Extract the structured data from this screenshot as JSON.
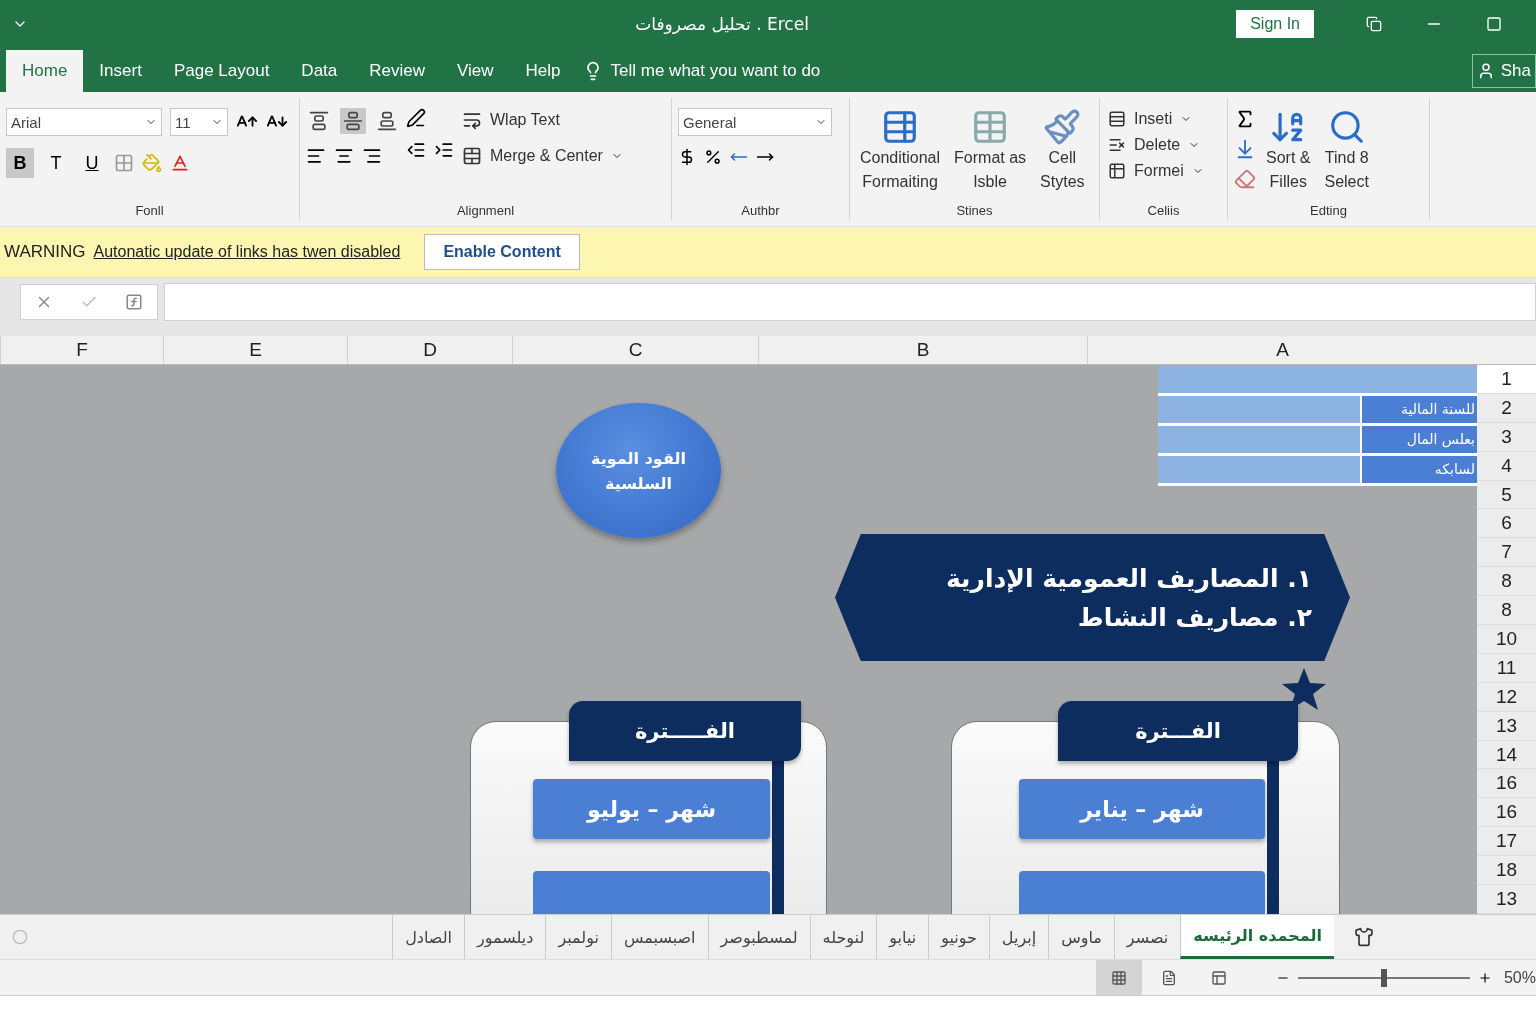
{
  "window": {
    "title": "تحليل مصروفات . Ercel",
    "sign_in": "Sign In",
    "share": "Sha"
  },
  "ribbon_tabs": {
    "home": {
      "label": "Home",
      "selected": true
    },
    "insert": {
      "label": "Insert",
      "selected": false
    },
    "page_layout": {
      "label": "Page Layout",
      "selected": false
    },
    "data": {
      "label": "Data",
      "selected": false
    },
    "review": {
      "label": "Review",
      "selected": false
    },
    "view": {
      "label": "View",
      "selected": false
    },
    "help": {
      "label": "Help",
      "selected": false
    }
  },
  "tell_me": "Tell me what you want to do",
  "ribbon": {
    "font": "Arial",
    "size": "11",
    "format_buttons": {
      "bold": {
        "label": "B",
        "selected": true
      },
      "italic": {
        "label": "T",
        "selected": false
      },
      "underline": {
        "label": "U",
        "selected": false
      }
    },
    "vertical_align": [
      {
        "selected": false
      },
      {
        "selected": true
      },
      {
        "selected": false
      }
    ],
    "wrap_text": "Wlap Text",
    "merge": "Merge & Center",
    "number_format": "General",
    "conditional": [
      "Conditional",
      "Formaiting"
    ],
    "format_table": [
      "Format as",
      "Isble"
    ],
    "cell_styles": [
      "Cell",
      "Stytes"
    ],
    "insert": "Inseti",
    "delete": "Delete",
    "format": "Formei",
    "sort": [
      "Sort &",
      "Filles"
    ],
    "find": [
      "Tind 8",
      "Select"
    ],
    "group_labels": {
      "font": "Fonll",
      "alignment": "Alignmenl",
      "number": "Authbr",
      "styles": "Stines",
      "cells": "Celiis",
      "editing": "Edting"
    }
  },
  "warning": {
    "label": "WARNING",
    "message": "Autonatic update of links has twen disabled",
    "button": "Enable Content"
  },
  "columns": [
    "A",
    "B",
    "C",
    "D",
    "E",
    "F"
  ],
  "rows": [
    "1",
    "2",
    "3",
    "4",
    "5",
    "6",
    "7",
    "8",
    "8",
    "10",
    "11",
    "12",
    "13",
    "14",
    "16",
    "16",
    "17",
    "18",
    "13"
  ],
  "cells": [
    "للسنة المالية",
    "بعلس المال",
    "لسابكه"
  ],
  "oval": [
    "القود الموية",
    "السلسية"
  ],
  "banner": [
    "١. المصاريف العمومية الإدارية",
    "٢. مصاريف النشاط"
  ],
  "cards": [
    {
      "title": "الفـــترة",
      "month": "شهر – يناير"
    },
    {
      "title": "الفـــــترة",
      "month": "شهر – يوليو"
    }
  ],
  "sheet_tabs": [
    {
      "label": "المحمده الرئيسه",
      "selected": true
    },
    {
      "label": "نصسر",
      "selected": false
    },
    {
      "label": "ماوس",
      "selected": false
    },
    {
      "label": "إبريل",
      "selected": false
    },
    {
      "label": "حونيو",
      "selected": false
    },
    {
      "label": "نيابو",
      "selected": false
    },
    {
      "label": "لنوحله",
      "selected": false
    },
    {
      "label": "لمسطبوصر",
      "selected": false
    },
    {
      "label": "اصبسبمس",
      "selected": false
    },
    {
      "label": "نولمبر",
      "selected": false
    },
    {
      "label": "ديلسمور",
      "selected": false
    },
    {
      "label": "الصادل",
      "selected": false
    }
  ],
  "view_modes": [
    {
      "selected": true
    },
    {
      "selected": false
    },
    {
      "selected": false
    }
  ],
  "zoom": {
    "level": 0.5,
    "reading": "50%"
  }
}
